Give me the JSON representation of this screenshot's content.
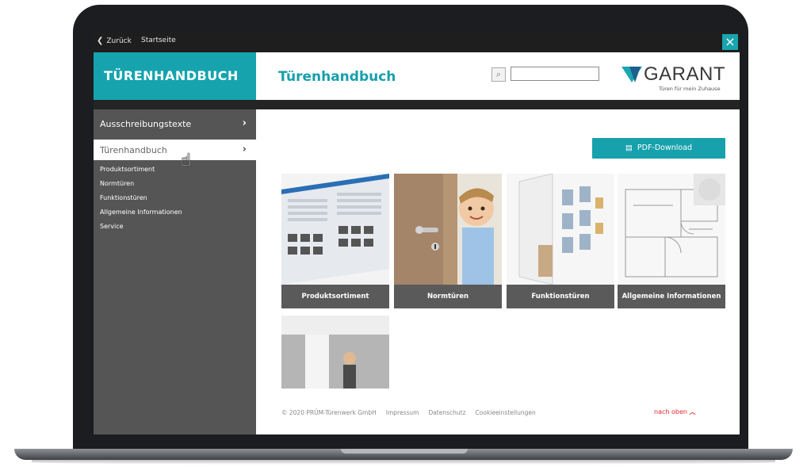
{
  "topbar": {
    "back_label": "Zurück",
    "home_label": "Startseite",
    "close_label": "×"
  },
  "sidebar_header": {
    "title": "TÜRENHANDBUCH"
  },
  "main_header": {
    "title": "Türenhandbuch",
    "search_placeholder": ""
  },
  "logo": {
    "brand": "GARANT",
    "tagline": "Türen für mein Zuhause"
  },
  "sidebar": {
    "items": [
      {
        "label": "Ausschreibungstexte",
        "arrow": "›"
      },
      {
        "label": "Türenhandbuch",
        "arrow": "›"
      }
    ],
    "subitems": [
      "Produktsortiment",
      "Normtüren",
      "Funktionstüren",
      "Allgemeine Informationen",
      "Service"
    ]
  },
  "content": {
    "pdf_button": "PDF-Download",
    "tiles": [
      {
        "caption": "Produktsortiment"
      },
      {
        "caption": "Normtüren"
      },
      {
        "caption": "Funktionstüren"
      },
      {
        "caption": "Allgemeine Informationen"
      }
    ]
  },
  "footer": {
    "copyright": "© 2020 PRÜM-Türenwerk GmbH",
    "links": [
      "Impressum",
      "Datenschutz",
      "Cookieeinstellungen"
    ],
    "to_top": "nach oben"
  },
  "colors": {
    "accent": "#16a3ae",
    "sidebar": "#555555",
    "to_top": "#e4262c"
  }
}
